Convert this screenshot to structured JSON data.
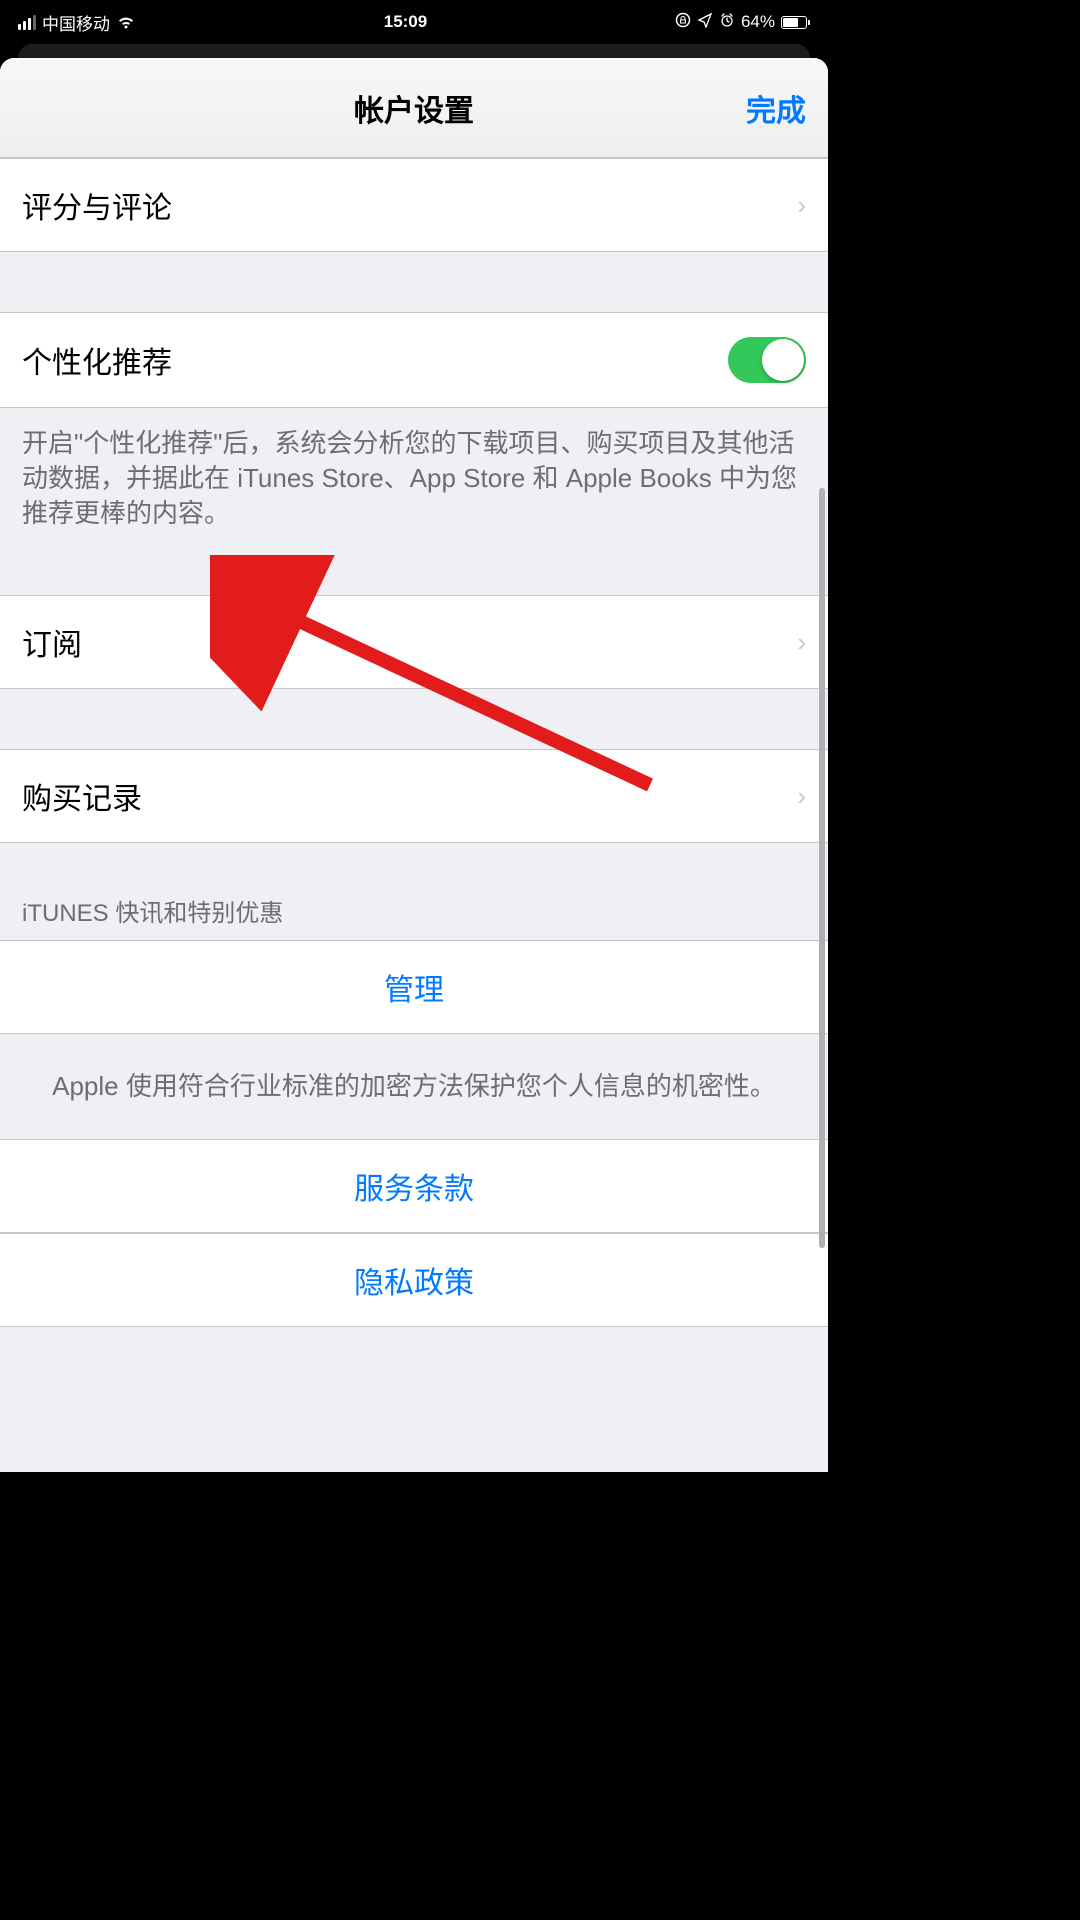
{
  "status_bar": {
    "carrier": "中国移动",
    "time": "15:09",
    "battery_pct": "64%"
  },
  "header": {
    "title": "帐户设置",
    "done": "完成"
  },
  "rows": {
    "ratings_reviews": "评分与评论",
    "personalized": "个性化推荐",
    "personalized_footer": "开启\"个性化推荐\"后，系统会分析您的下载项目、购买项目及其他活动数据，并据此在 iTunes Store、App Store 和 Apple Books 中为您推荐更棒的内容。",
    "subscriptions": "订阅",
    "purchase_history": "购买记录",
    "itunes_header": "iTUNES 快讯和特别优惠",
    "manage": "管理",
    "encryption_note": "Apple 使用符合行业标准的加密方法保护您个人信息的机密性。",
    "terms": "服务条款",
    "privacy": "隐私政策"
  }
}
